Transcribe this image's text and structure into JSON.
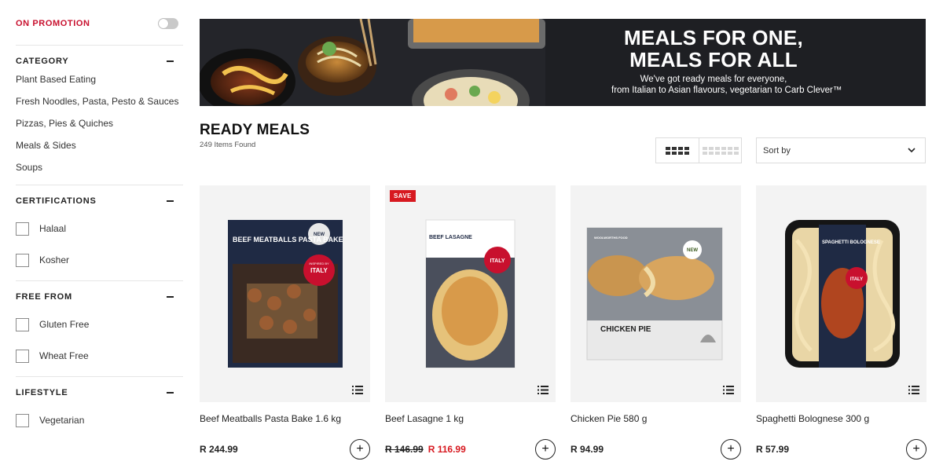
{
  "sidebar": {
    "promotion_label": "ON PROMOTION",
    "category": {
      "title": "CATEGORY",
      "items": [
        "Plant Based Eating",
        "Fresh Noodles, Pasta, Pesto & Sauces",
        "Pizzas, Pies & Quiches",
        "Meals & Sides",
        "Soups"
      ]
    },
    "certifications": {
      "title": "CERTIFICATIONS",
      "items": [
        "Halaal",
        "Kosher"
      ]
    },
    "free_from": {
      "title": "FREE FROM",
      "items": [
        "Gluten Free",
        "Wheat Free"
      ]
    },
    "lifestyle": {
      "title": "LIFESTYLE",
      "items": [
        "Vegetarian"
      ]
    }
  },
  "banner": {
    "headline_1": "MEALS FOR ONE,",
    "headline_2": "MEALS FOR ALL",
    "sub_1": "We've got ready meals for everyone,",
    "sub_2": "from Italian to Asian flavours, vegetarian to Carb Clever™"
  },
  "main": {
    "title": "READY MEALS",
    "items_found": "249 Items Found",
    "sort_label": "Sort by"
  },
  "products": [
    {
      "name": "Beef Meatballs Pasta Bake 1.6 kg",
      "price": "R 244.99",
      "badge": "",
      "old_price": "",
      "pack": "BEEF MEATBALLS PASTA BAKE"
    },
    {
      "name": "Beef Lasagne 1 kg",
      "price": "R 116.99",
      "badge": "SAVE",
      "old_price": "R 146.99",
      "pack": "BEEF LASAGNE"
    },
    {
      "name": "Chicken Pie 580 g",
      "price": "R 94.99",
      "badge": "",
      "old_price": "",
      "pack": "CHICKEN PIE"
    },
    {
      "name": "Spaghetti Bolognese 300 g",
      "price": "R 57.99",
      "badge": "",
      "old_price": "",
      "pack": "SPAGHETTI BOLOGNESE"
    }
  ],
  "pack_text": {
    "brand": "WOOLWORTHS FOOD",
    "new": "NEW",
    "italy": "ITALY",
    "inspired": "INSPIRED BY"
  },
  "colors": {
    "accent_red": "#d71920",
    "promo_red": "#c8102e",
    "banner_bg": "#1e1f23",
    "tile_bg": "#f3f3f3"
  },
  "icons": {
    "toggle": "toggle-switch-icon",
    "collapse": "minus-icon",
    "grid_large": "grid-4-icon",
    "grid_small": "grid-6-icon",
    "sort_chevron": "chevron-down-icon",
    "tile_menu": "list-icon",
    "add": "plus-icon"
  }
}
